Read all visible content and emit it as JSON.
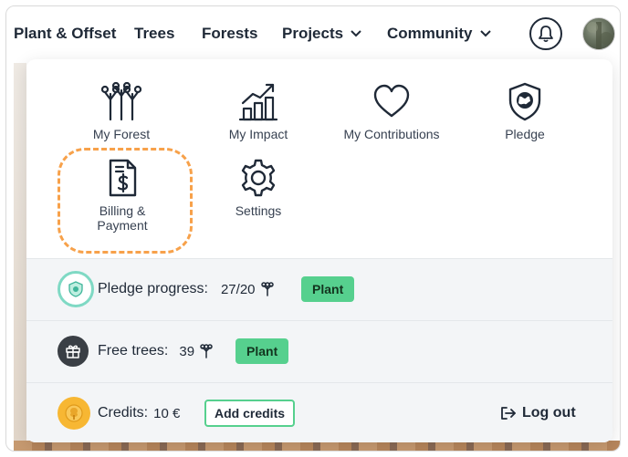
{
  "nav": {
    "items": [
      {
        "label": "Plant & Offset"
      },
      {
        "label": "Trees"
      },
      {
        "label": "Forests"
      },
      {
        "label": "Projects"
      },
      {
        "label": "Community"
      }
    ],
    "bell_icon": "bell-icon",
    "avatar_icon": "avatar"
  },
  "menu": {
    "items": [
      {
        "label": "My Forest",
        "icon": "trees-icon"
      },
      {
        "label": "My Impact",
        "icon": "chart-icon"
      },
      {
        "label": "My Contributions",
        "icon": "heart-icon"
      },
      {
        "label": "Pledge",
        "icon": "shield-globe-icon"
      },
      {
        "label": "Billing & Payment",
        "icon": "billing-document-icon"
      },
      {
        "label": "Settings",
        "icon": "gear-icon"
      }
    ],
    "highlight_color": "#f7a14a"
  },
  "rows": {
    "pledge": {
      "label": "Pledge progress:",
      "value": "27/20",
      "button": "Plant"
    },
    "free_trees": {
      "label": "Free trees:",
      "value": "39",
      "button": "Plant"
    },
    "credits": {
      "label": "Credits:",
      "value": "10 €",
      "button": "Add credits",
      "logout": "Log out"
    }
  },
  "colors": {
    "accent_green": "#56d08e",
    "text": "#1f2937",
    "row_bg": "#f3f5f7"
  }
}
